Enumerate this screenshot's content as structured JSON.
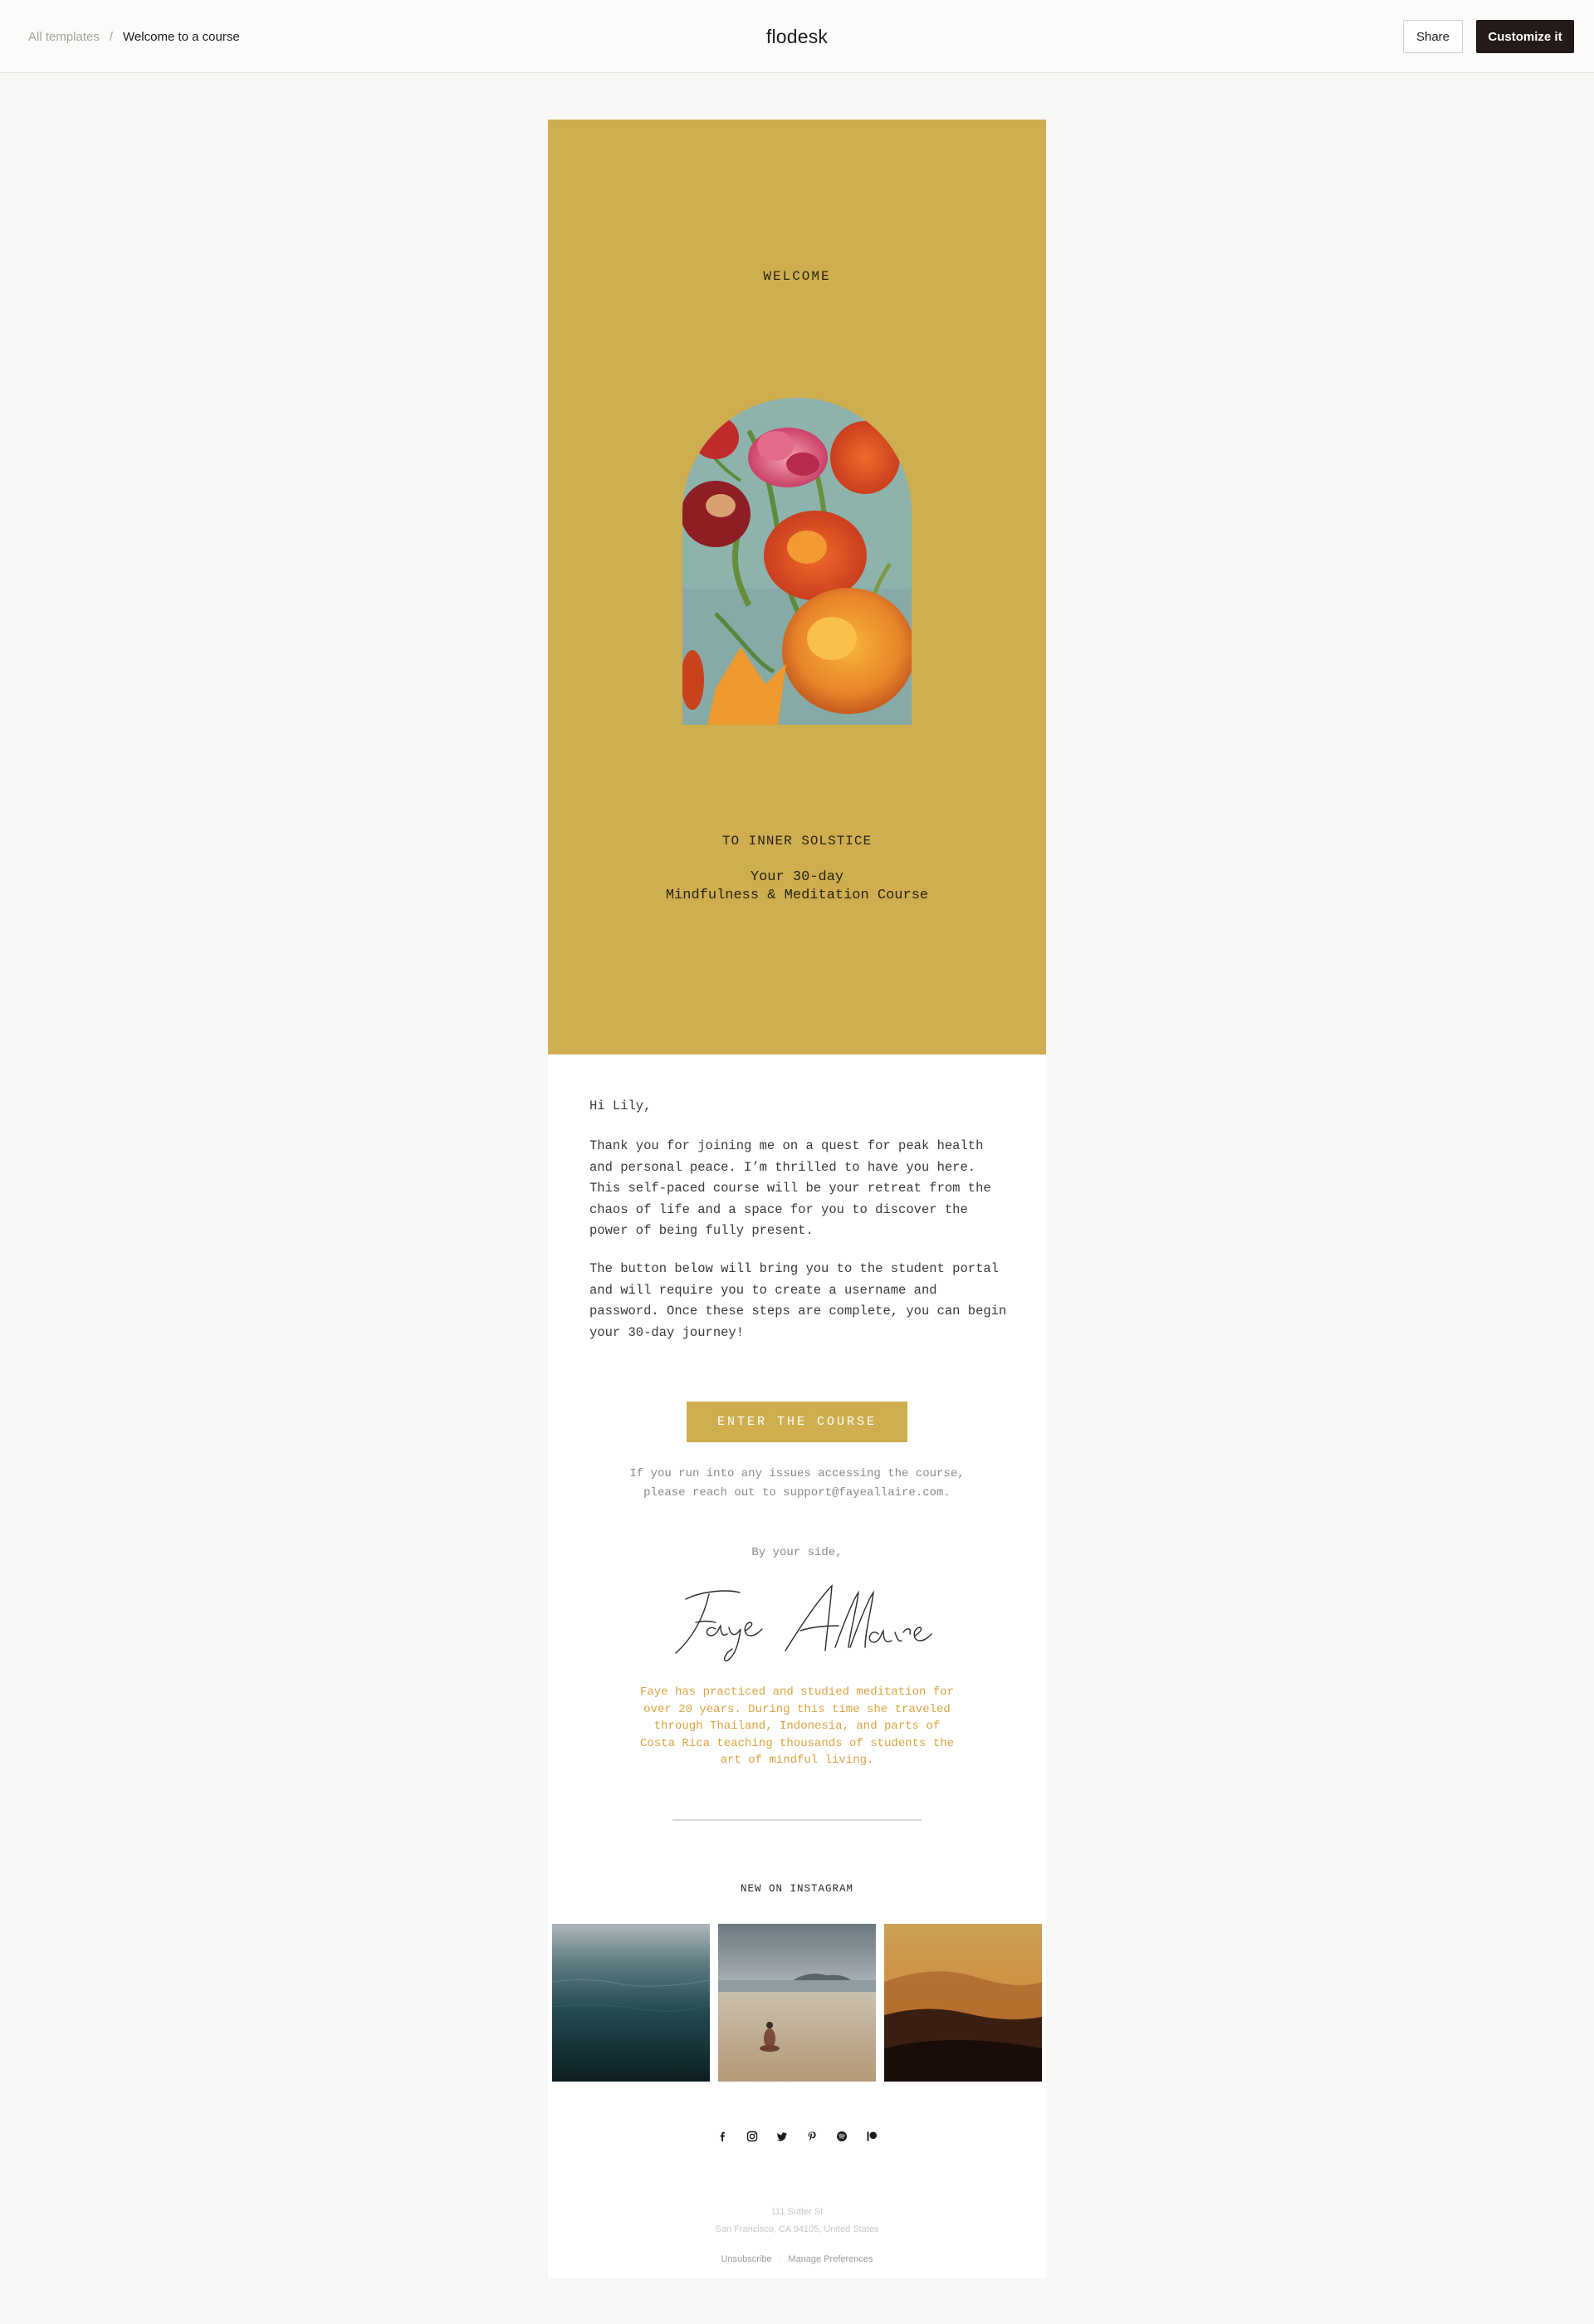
{
  "header": {
    "breadcrumb_root": "All templates",
    "breadcrumb_separator": "/",
    "breadcrumb_current": "Welcome to a course",
    "brand": "flodesk",
    "share_label": "Share",
    "customize_label": "Customize it"
  },
  "email": {
    "colors": {
      "accent": "#ceae4f",
      "bio_text": "#d9a441",
      "hero_text": "#2a2415"
    },
    "hero": {
      "welcome": "WELCOME",
      "brand_line": "TO INNER SOLSTICE",
      "subtitle_line1": "Your 30-day",
      "subtitle_line2": "Mindfulness & Meditation Course"
    },
    "greeting": "Hi Lily,",
    "paragraph1": "Thank you for joining me on a quest for peak health and personal peace. I’m thrilled to have you here. This self-paced course will be your retreat from the chaos of life and a space for you to discover the power of being fully present.",
    "paragraph2": "The button below will bring you to the student portal and will require you to create a username and password. Once these steps are complete, you can begin your 30-day journey!",
    "cta_label": "ENTER THE COURSE",
    "support_line1": "If you run into any issues accessing the course,",
    "support_line2": "please reach out to support@fayeallaire.com.",
    "sign_off": "By your side,",
    "signature": "Faye Allaire",
    "bio": "Faye has practiced and studied meditation for over 20 years. During this time she traveled through Thailand, Indonesia, and parts of Costa Rica teaching thousands of students the art of mindful living.",
    "instagram_title": "NEW ON INSTAGRAM",
    "instagram_photos": [
      "ocean-water-photo",
      "beach-meditation-photo",
      "mountain-sunset-photo"
    ],
    "social_icons": [
      "facebook-icon",
      "instagram-icon",
      "twitter-icon",
      "pinterest-icon",
      "spotify-icon",
      "patreon-icon"
    ],
    "address_line1": "111 Sutter St",
    "address_line2": "San Francisco, CA 94105, United States",
    "unsubscribe_label": "Unsubscribe",
    "footer_separator": "·",
    "manage_label": "Manage Preferences"
  }
}
